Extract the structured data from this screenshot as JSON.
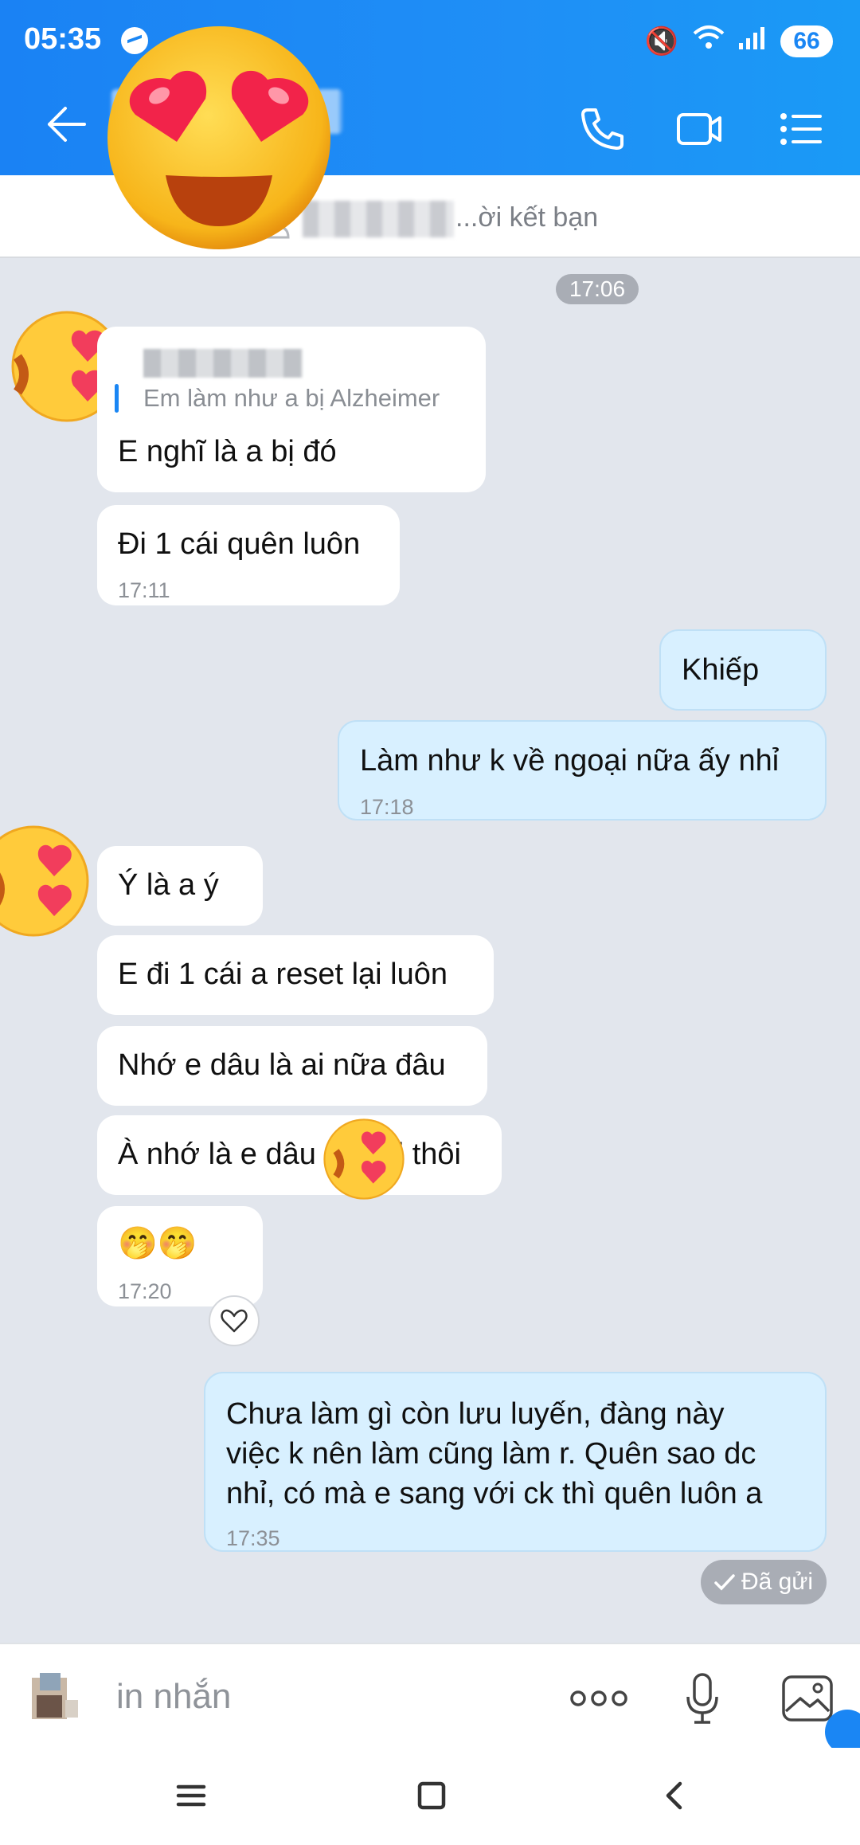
{
  "status": {
    "time": "05:35",
    "battery": "66",
    "network": "6"
  },
  "header": {
    "back_icon": "arrow-left-icon",
    "call_icon": "phone-icon",
    "video_icon": "video-camera-icon",
    "menu_icon": "list-menu-icon"
  },
  "friend_request": {
    "label": "...ời kết bạn"
  },
  "day_divider": {
    "time": "17:06"
  },
  "messages": [
    {
      "dir": "in",
      "quote": "Em làm như a bị Alzheimer",
      "text": "E nghĩ là a bị đó",
      "time": ""
    },
    {
      "dir": "in",
      "text": "Đi 1 cái quên luôn",
      "time": "17:11"
    },
    {
      "dir": "out",
      "text": "Khiếp",
      "time": ""
    },
    {
      "dir": "out",
      "text": "Làm như k về ngoại nữa ấy nhỉ",
      "time": "17:18"
    },
    {
      "dir": "in",
      "text": "Ý là a ý",
      "time": ""
    },
    {
      "dir": "in",
      "text": "E đi 1 cái a reset lại luôn",
      "time": ""
    },
    {
      "dir": "in",
      "text": "Nhớ e dâu là ai nữa đâu",
      "time": ""
    },
    {
      "dir": "in",
      "text": "À nhớ là e dâu",
      "text_tail": "d thôi",
      "time": ""
    },
    {
      "dir": "in",
      "text": "🤭🤭",
      "time": "17:20"
    },
    {
      "dir": "out",
      "lines": [
        "Chưa làm gì còn lưu luyến, đàng này",
        "việc k nên làm cũng làm r. Quên sao dc",
        "nhỉ, có mà e sang với ck thì quên luôn a"
      ],
      "time": "17:35"
    }
  ],
  "sent_status": "Đã gửi",
  "composer": {
    "placeholder": "in nhắn",
    "more_icon": "more-dots-icon",
    "mic_icon": "microphone-icon",
    "image_icon": "image-icon"
  },
  "navbar": {
    "menu_icon": "recent-apps-icon",
    "home_icon": "home-square-icon",
    "back_icon": "back-chevron-icon"
  },
  "colors": {
    "header": "#1a86f4",
    "outgoing": "#d8f0ff",
    "background": "#e2e6ed"
  }
}
